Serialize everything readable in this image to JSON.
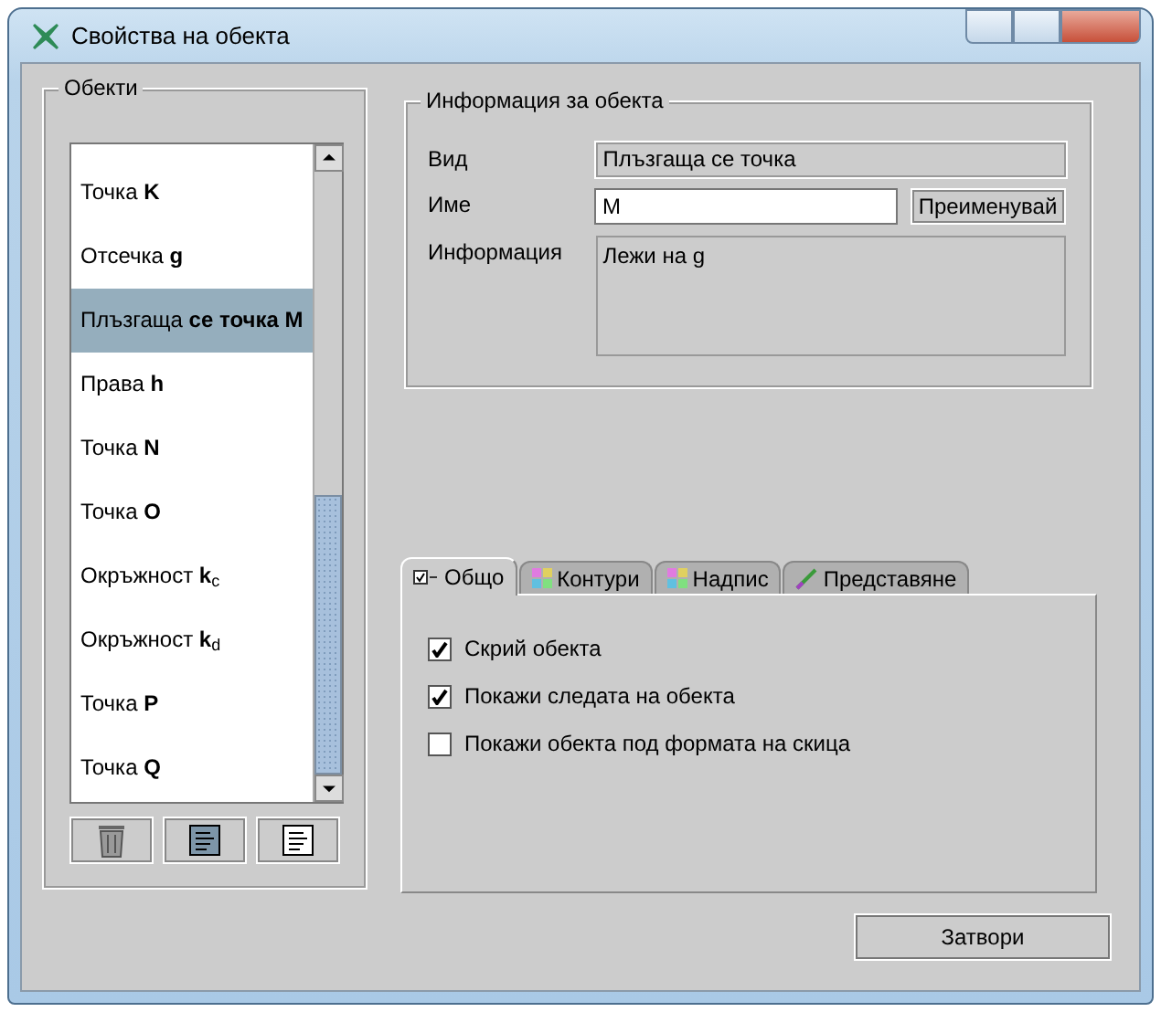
{
  "window": {
    "title": "Свойства на обекта"
  },
  "objects": {
    "title": "Обекти",
    "items": [
      {
        "label": "Точка **K**",
        "selected": false
      },
      {
        "label": "Отсечка **g**",
        "selected": false
      },
      {
        "label": "Плъзгаща **се точка M**",
        "selected": true
      },
      {
        "label": "Права **h**",
        "selected": false
      },
      {
        "label": "Точка **N**",
        "selected": false
      },
      {
        "label": "Точка **O**",
        "selected": false
      },
      {
        "label": "Окръжност **k**$_{c}$",
        "selected": false
      },
      {
        "label": "Окръжност **k**$_{d}$",
        "selected": false
      },
      {
        "label": "Точка **P**",
        "selected": false
      },
      {
        "label": "Точка **Q**",
        "selected": false
      }
    ]
  },
  "info": {
    "title": "Информация за обекта",
    "type_label": "Вид",
    "type_value": "Плъзгаща се точка",
    "name_label": "Име",
    "name_value": "M",
    "rename_button": "Преименувай",
    "info_label": "Информация",
    "info_value": "Лежи на g"
  },
  "tabs": [
    {
      "label": "Общо",
      "selected": true
    },
    {
      "label": "Контури",
      "selected": false
    },
    {
      "label": "Надпис",
      "selected": false
    },
    {
      "label": "Представяне",
      "selected": false
    }
  ],
  "options": [
    {
      "label": "Скрий обекта",
      "checked": true
    },
    {
      "label": "Покажи следата на обекта",
      "checked": true
    },
    {
      "label": "Покажи обекта под формата на скица",
      "checked": false
    }
  ],
  "close_button": "Затвори"
}
